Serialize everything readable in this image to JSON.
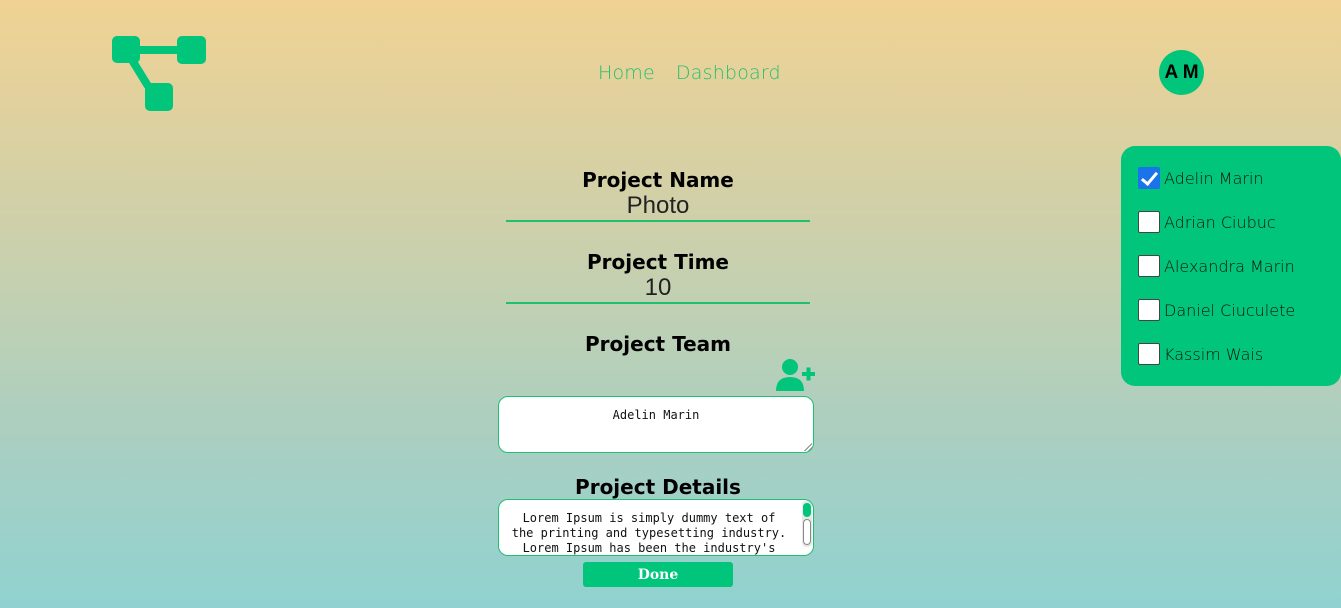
{
  "nav": {
    "home": "Home",
    "dashboard": "Dashboard"
  },
  "user": {
    "initials": "A M"
  },
  "form": {
    "project_name_label": "Project Name",
    "project_name_value": "Photo",
    "project_time_label": "Project Time",
    "project_time_value": "10",
    "project_team_label": "Project Team",
    "project_team_value": "Adelin Marin",
    "project_details_label": "Project Details",
    "project_details_value": "Lorem Ipsum is simply dummy text of the printing and typesetting industry. Lorem Ipsum has been the industry's",
    "done_label": "Done"
  },
  "members": [
    {
      "name": "Adelin Marin",
      "checked": true
    },
    {
      "name": "Adrian Ciubuc",
      "checked": false
    },
    {
      "name": "Alexandra Marin",
      "checked": false
    },
    {
      "name": "Daniel Ciuculete",
      "checked": false
    },
    {
      "name": "Kassim Wais",
      "checked": false
    }
  ],
  "colors": {
    "accent": "#00c57a",
    "checkbox_checked": "#1a73e8"
  },
  "icons": {
    "logo": "flow-diagram-logo",
    "add_member": "add-user-icon"
  }
}
